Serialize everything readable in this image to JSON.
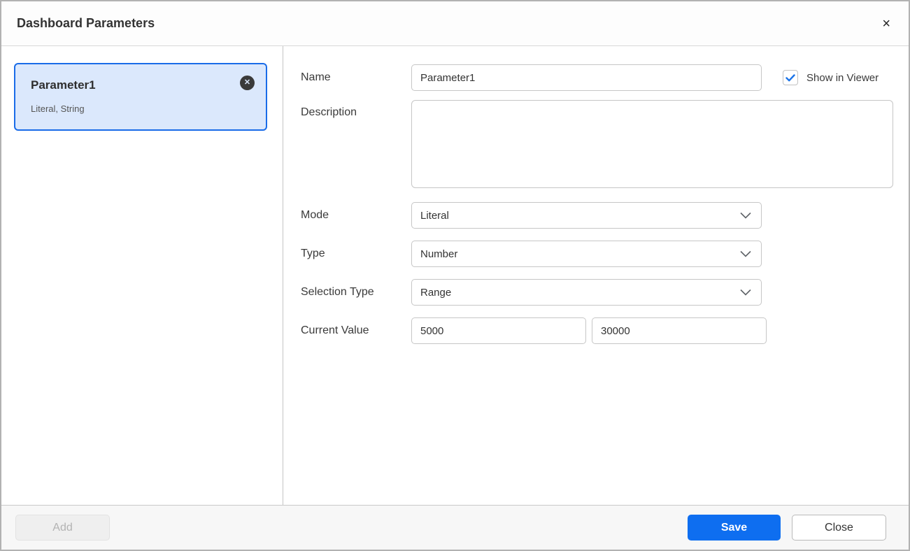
{
  "dialog": {
    "title": "Dashboard Parameters",
    "close_icon": "×"
  },
  "parameter_list": {
    "items": [
      {
        "name": "Parameter1",
        "subtitle": "Literal, String",
        "selected": true,
        "remove_icon": "✕"
      }
    ]
  },
  "form": {
    "name": {
      "label": "Name",
      "value": "Parameter1"
    },
    "show_in_viewer": {
      "label": "Show in Viewer",
      "checked": true
    },
    "description": {
      "label": "Description",
      "value": ""
    },
    "mode": {
      "label": "Mode",
      "value": "Literal"
    },
    "type": {
      "label": "Type",
      "value": "Number"
    },
    "selection_type": {
      "label": "Selection Type",
      "value": "Range"
    },
    "current_value": {
      "label": "Current Value",
      "from": "5000",
      "to": "30000"
    }
  },
  "footer": {
    "add_label": "Add",
    "save_label": "Save",
    "close_label": "Close"
  },
  "colors": {
    "accent_blue": "#0e6ef0",
    "selected_card_border": "#1a6ce8",
    "selected_card_bg": "#dbe8fc",
    "checkbox_check": "#1a73e8"
  }
}
